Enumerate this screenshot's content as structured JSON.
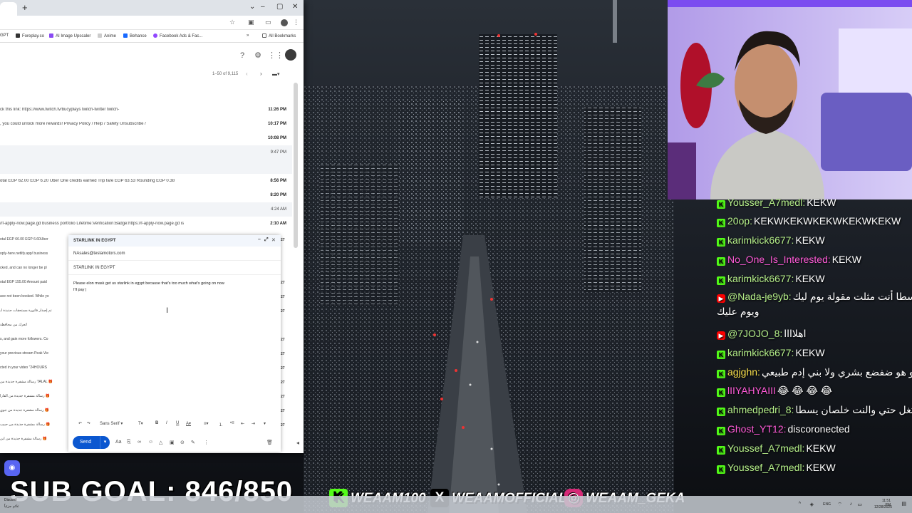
{
  "browser": {
    "bookmarks": [
      {
        "label": "GPT",
        "color": "#10a37f"
      },
      {
        "label": "Foreplay.co",
        "color": "#333333"
      },
      {
        "label": "AI Image Upscaler",
        "color": "#8a4af3"
      },
      {
        "label": "Anime",
        "color": "#e0e0e0"
      },
      {
        "label": "Behance",
        "color": "#1769ff"
      },
      {
        "label": "Facebook Ads & Fac...",
        "color": "#9146ff"
      }
    ],
    "all_bookmarks": "All Bookmarks"
  },
  "gmail": {
    "pager": "1–50 of 9,115",
    "rows": [
      {
        "snippet": "ck this link: https://www.twitch.tv/bucyplays twitch-twitter twitch-",
        "time": "11:26 PM",
        "bold": true
      },
      {
        "snippet": ", you could unlock more rewards! Privacy Policy / Help / Safety Unsubscribe /",
        "time": "10:17 PM",
        "bold": true
      },
      {
        "snippet": "",
        "time": "10:08 PM",
        "bold": true
      },
      {
        "snippet": "",
        "time": "9:47 PM",
        "bold": false
      },
      {
        "snippet": "",
        "time": "",
        "bold": false
      },
      {
        "snippet": "otal EGP 62.00 EGP 6.20 Uber One credits earned Trip fare EGP 63.53 Rounding EGP 0.38",
        "time": "8:56 PM",
        "bold": true
      },
      {
        "snippet": "",
        "time": "8:20 PM",
        "bold": true
      },
      {
        "snippet": "",
        "time": "4:24 AM",
        "bold": false
      },
      {
        "snippet": "//f-apply-now.page.gd business portfolio Lifetime:Verification:Badge:https://f-apply-now.page.gd is",
        "time": "2:10 AM",
        "bold": true
      }
    ],
    "left_rows": [
      "otal EGP 66.00 EGP 6.60Uber",
      "oply-here.netlify.app/ business",
      "cked, and can no longer be pl",
      "otal EGP 155.00 Amount paid",
      "ave not been booked. While yo",
      "تم إصدار فاتورة مستحقات جديدة لـ",
      "اتعرك من محافظة",
      "s, and gain more followers. Co",
      "your previous stream Peak Vie",
      "cted in your video \"24HOURS",
      "رسالة مشفرة جديدة من TALAL 🎁",
      "رسالة مشفرة جديدة من الفارا 🎁",
      "رسالة مشفرة جديدة من جوي 🎁",
      "رسالة مشفرة جديدة من حبيب 🎁",
      "رسالة مشفرة جديدة من ابن 🎁"
    ],
    "left_times": [
      "27",
      "",
      "",
      "27",
      "27",
      "27",
      "",
      "27",
      "27",
      "27",
      "27",
      "27",
      "27",
      "27"
    ]
  },
  "compose": {
    "title": "STARLINK IN EGYPT",
    "to": "NAsales@teslamotors.com",
    "subject": "STARLINK IN EGYPT",
    "body_line1": "Please elon mask get us starlink in egypt because that's too much what's going on now",
    "body_line2": "I'll pay |",
    "font": "Sans Serif",
    "send_label": "Send"
  },
  "chat": {
    "messages": [
      {
        "badge": "kick",
        "user": "Yousser_A7medl:",
        "text": "KEKW",
        "color": "green"
      },
      {
        "badge": "kick",
        "user": "20op:",
        "text": "KEKWKEKWKEKWKEKWKEKW",
        "color": "green"
      },
      {
        "badge": "kick",
        "user": "karimkick6677:",
        "text": "KEKW",
        "color": "green"
      },
      {
        "badge": "kick",
        "user": "No_One_Is_Interested:",
        "text": "KEKW",
        "color": "pink"
      },
      {
        "badge": "kick",
        "user": "karimkick6677:",
        "text": "KEKW",
        "color": "green"
      },
      {
        "badge": "youtube",
        "user": "@Nada-je9yb:",
        "text": "يسطا أنت مثلت مقولة يوم ليك",
        "text2": "ويوم عليك",
        "color": "green"
      },
      {
        "badge": "youtube",
        "user": "@7JOJO_8:",
        "text": "اهلاااا",
        "color": "green"
      },
      {
        "badge": "kick",
        "user": "karimkick6677:",
        "text": "KEKW",
        "color": "green"
      },
      {
        "badge": "kick",
        "user": "agjghn:",
        "text": "اسألو هو ضفضع بشري ولا بني إدم طبيعي",
        "color": "yellow"
      },
      {
        "badge": "kick",
        "user": "lIIYAHYAIII",
        "text": "😂 😂 😂 😂",
        "color": "pink"
      },
      {
        "badge": "kick",
        "user": "ahmedpedri_8:",
        "text": "بيشتغل حتي والنت خلصان يسطا",
        "color": "green"
      },
      {
        "badge": "kick",
        "user": "Ghost_YT12:",
        "text": "discoronected",
        "color": "pink"
      },
      {
        "badge": "kick",
        "user": "Youssef_A7medl:",
        "text": "KEKW",
        "color": "green"
      },
      {
        "badge": "kick",
        "user": "Youssef_A7medl:",
        "text": "KEKW",
        "color": "green"
      }
    ]
  },
  "overlay": {
    "sub_goal": "SUB GOAL: 846/850",
    "kick_handle": "WEAAM100",
    "x_handle": "WEAAMOFFICIAL",
    "ig_handle": "WEAAM_GEKA"
  },
  "taskbar": {
    "lang": "ENG",
    "time": "11:51 PM",
    "date": "12/28/2025",
    "discord_label": "Discord",
    "weather_label": "غائم جزئياً"
  },
  "colors": {
    "kick": "#53fc18",
    "youtube": "#ff0000",
    "gmail_send": "#0b57d0"
  }
}
